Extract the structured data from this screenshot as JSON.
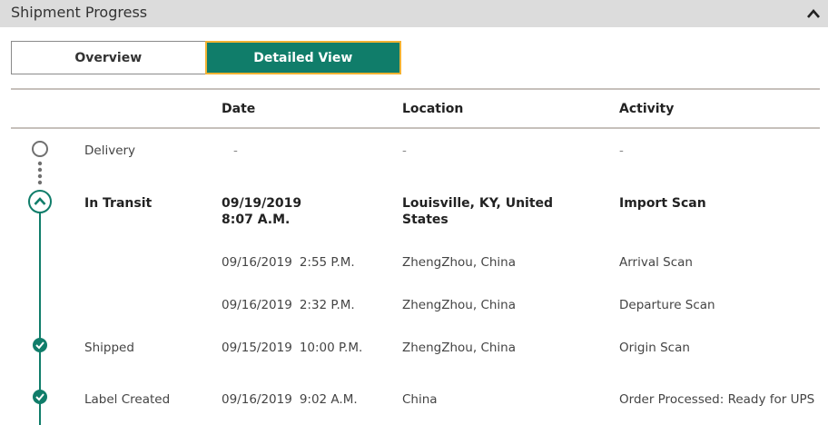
{
  "header": {
    "title": "Shipment Progress",
    "collapse_icon": "chevron-up-icon"
  },
  "view_toggle": {
    "overview_label": "Overview",
    "detailed_label": "Detailed View",
    "selected": "Detailed View"
  },
  "table": {
    "columns": [
      "Date",
      "Location",
      "Activity"
    ],
    "rows": [
      {
        "status": "Delivery",
        "date": "-",
        "time": "",
        "location": "-",
        "activity": "-",
        "marker": "empty-circle-icon"
      },
      {
        "status": "In Transit",
        "date": "09/19/2019",
        "time": "8:07 A.M.",
        "location": "Louisville, KY, United States",
        "activity": "Import Scan",
        "marker": "chevron-up-circle-icon"
      },
      {
        "status": "",
        "date": "09/16/2019",
        "time": "2:55 P.M.",
        "location": "ZhengZhou, China",
        "activity": "Arrival Scan"
      },
      {
        "status": "",
        "date": "09/16/2019",
        "time": "2:32 P.M.",
        "location": "ZhengZhou, China",
        "activity": "Departure Scan"
      },
      {
        "status": "Shipped",
        "date": "09/15/2019",
        "time": "10:00 P.M.",
        "location": "ZhengZhou, China",
        "activity": "Origin Scan",
        "marker": "check-circle-icon"
      },
      {
        "status": "Label Created",
        "date": "09/16/2019",
        "time": "9:02 A.M.",
        "location": "China",
        "activity": "Order Processed: Ready for UPS",
        "marker": "check-circle-icon"
      }
    ]
  },
  "colors": {
    "accent": "#107d6a",
    "focus_border": "#f2b233",
    "header_bg": "#dcdcdc"
  }
}
